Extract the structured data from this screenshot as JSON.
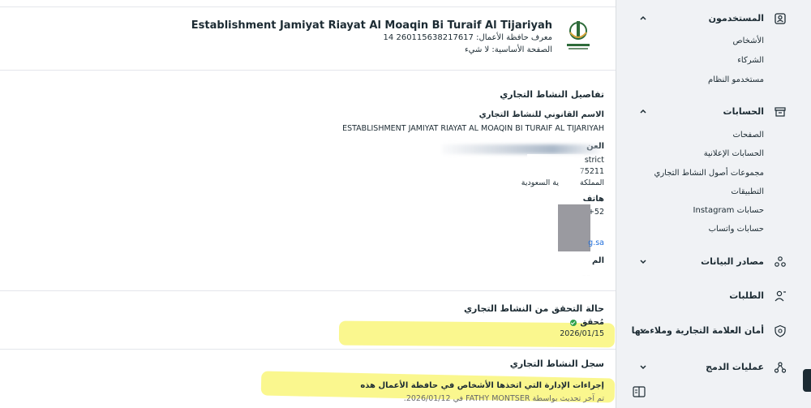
{
  "business": {
    "name": "Establishment Jamiyat Riayat Al Moaqin Bi Turaif Al Tijariyah",
    "id_line": "معرف حافظة الأعمال: 260115638217617 14",
    "page_line": "الصفحة الأساسية: لا شيء"
  },
  "details": {
    "title": "تفاصيل النشاط التجاري",
    "legal_name_label": "الاسم القانوني للنشاط التجاري",
    "legal_name_value": "ESTABLISHMENT JAMIYAT RIAYAT AL MOAQIN BI TURAIF AL TIJARIYAH",
    "address_label": "العن",
    "address_line1": "strict",
    "address_line2": "75211 ",
    "address_line3_a": "المملكة",
    "address_line3_b": "ية السعودية",
    "phone_label": "هاتف",
    "phone_value": "+52",
    "website_value": "g.sa",
    "extra_label": "الم",
    "extra_value": "ـ ـ"
  },
  "verification": {
    "title": "حالة التحقق من النشاط التجاري",
    "status": "مُحقق",
    "date": "2026/01/15"
  },
  "activity_log": {
    "title": "سجل النشاط التجاري",
    "entry_title": "إجراءات الإدارة التي اتخذها الأشخاص في حافظة الأعمال هذه",
    "entry_meta": "تم آخر تحديث بواسطة FATHY MONTSER في 2026/01/12."
  },
  "sidebar": {
    "users": {
      "label": "المستخدمون",
      "items": [
        "الأشخاص",
        "الشركاء",
        "مستخدمو النظام"
      ]
    },
    "accounts": {
      "label": "الحسابات",
      "items": [
        "الصفحات",
        "الحسابات الإعلانية",
        "مجموعات أصول النشاط التجاري",
        "التطبيقات",
        "حسابات Instagram",
        "حسابات واتساب"
      ]
    },
    "data_sources": {
      "label": "مصادر البيانات"
    },
    "requests": {
      "label": "الطلبات"
    },
    "brand_safety": {
      "label": "أمان العلامة التجارية وملاءمتها"
    },
    "integrations": {
      "label": "عمليات الدمج"
    }
  },
  "colors": {
    "sidebar_bg": "#f0f2f5",
    "highlight": "#f8f56e",
    "verified_green": "#31a24c",
    "link_blue": "#216fdb"
  },
  "icons": [
    "users-icon",
    "accounts-icon",
    "data-sources-icon",
    "requests-icon",
    "shield-icon",
    "integrations-icon",
    "chevron-up-icon",
    "chevron-down-icon",
    "verified-check-icon",
    "panel-toggle-icon"
  ]
}
